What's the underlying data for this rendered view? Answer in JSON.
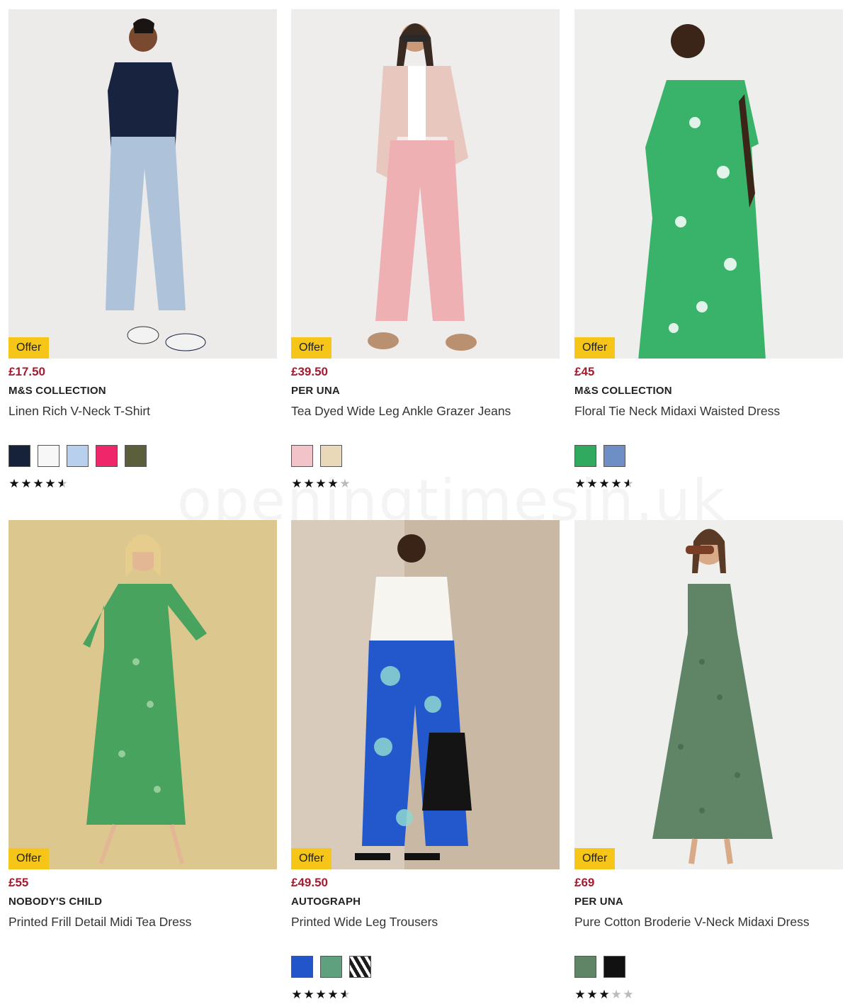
{
  "offer_label": "Offer",
  "watermark": "openingtimesin.uk",
  "products": [
    {
      "price": "£17.50",
      "brand": "M&S COLLECTION",
      "name": "Linen Rich V-Neck T-Shirt",
      "rating": 4.5,
      "swatches": [
        "#16213a",
        "#f7f7f7",
        "#b9cfee",
        "#f0266a",
        "#5b5f3c"
      ],
      "image_bg": "#ecebea"
    },
    {
      "price": "£39.50",
      "brand": "PER UNA",
      "name": "Tea Dyed Wide Leg Ankle Grazer Jeans",
      "rating": 4,
      "swatches": [
        "#f2c3c8",
        "#ead9b8"
      ],
      "image_bg": "#eeedeb"
    },
    {
      "price": "£45",
      "brand": "M&S COLLECTION",
      "name": "Floral Tie Neck Midaxi Waisted Dress",
      "rating": 4.5,
      "swatches": [
        "#2faa5e",
        "#6d8fc6"
      ],
      "image_bg": "#eeeeed"
    },
    {
      "price": "£55",
      "brand": "NOBODY'S CHILD",
      "name": "Printed Frill Detail Midi Tea Dress",
      "rating": null,
      "swatches": [],
      "image_bg": "#dcc88f"
    },
    {
      "price": "£49.50",
      "brand": "AUTOGRAPH",
      "name": "Printed Wide Leg Trousers",
      "rating": 4.5,
      "swatches": [
        "#2155c9",
        "#5fa07e",
        "#1c1c1c"
      ],
      "image_bg": "#c9b8a4"
    },
    {
      "price": "£69",
      "brand": "PER UNA",
      "name": "Pure Cotton Broderie V-Neck Midaxi Dress",
      "rating": 3,
      "swatches": [
        "#5f8566",
        "#111111"
      ],
      "image_bg": "#efefee"
    }
  ]
}
